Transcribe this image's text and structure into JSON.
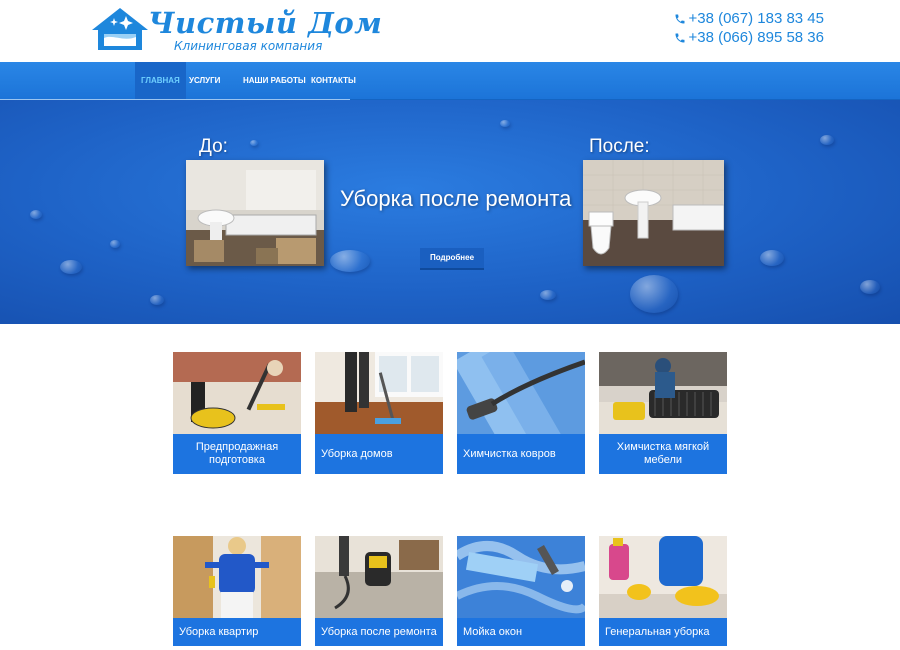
{
  "header": {
    "logo_title": "Чистый Дом",
    "logo_subtitle": "Клининговая компания",
    "phones": [
      "+38 (067) 183 83 45",
      "+38 (066) 895 58 36"
    ]
  },
  "nav": {
    "items": [
      {
        "label": "Главная"
      },
      {
        "label": "Услуги"
      },
      {
        "label": "Наши работы"
      },
      {
        "label": "Контакты"
      }
    ]
  },
  "hero": {
    "before_label": "До:",
    "after_label": "После:",
    "title": "Уборка после ремонта",
    "button_label": "Подробнее"
  },
  "services": [
    {
      "label": "Предпродажная подготовка"
    },
    {
      "label": "Уборка домов"
    },
    {
      "label": "Химчистка ковров"
    },
    {
      "label": "Химчистка мягкой мебели"
    },
    {
      "label": "Уборка квартир"
    },
    {
      "label": "Уборка после ремонта"
    },
    {
      "label": "Мойка окон"
    },
    {
      "label": "Генеральная уборка"
    }
  ],
  "colors": {
    "brand_blue": "#1e87dc",
    "nav_blue": "#2a86e6",
    "card_caption": "#1d74e0"
  }
}
